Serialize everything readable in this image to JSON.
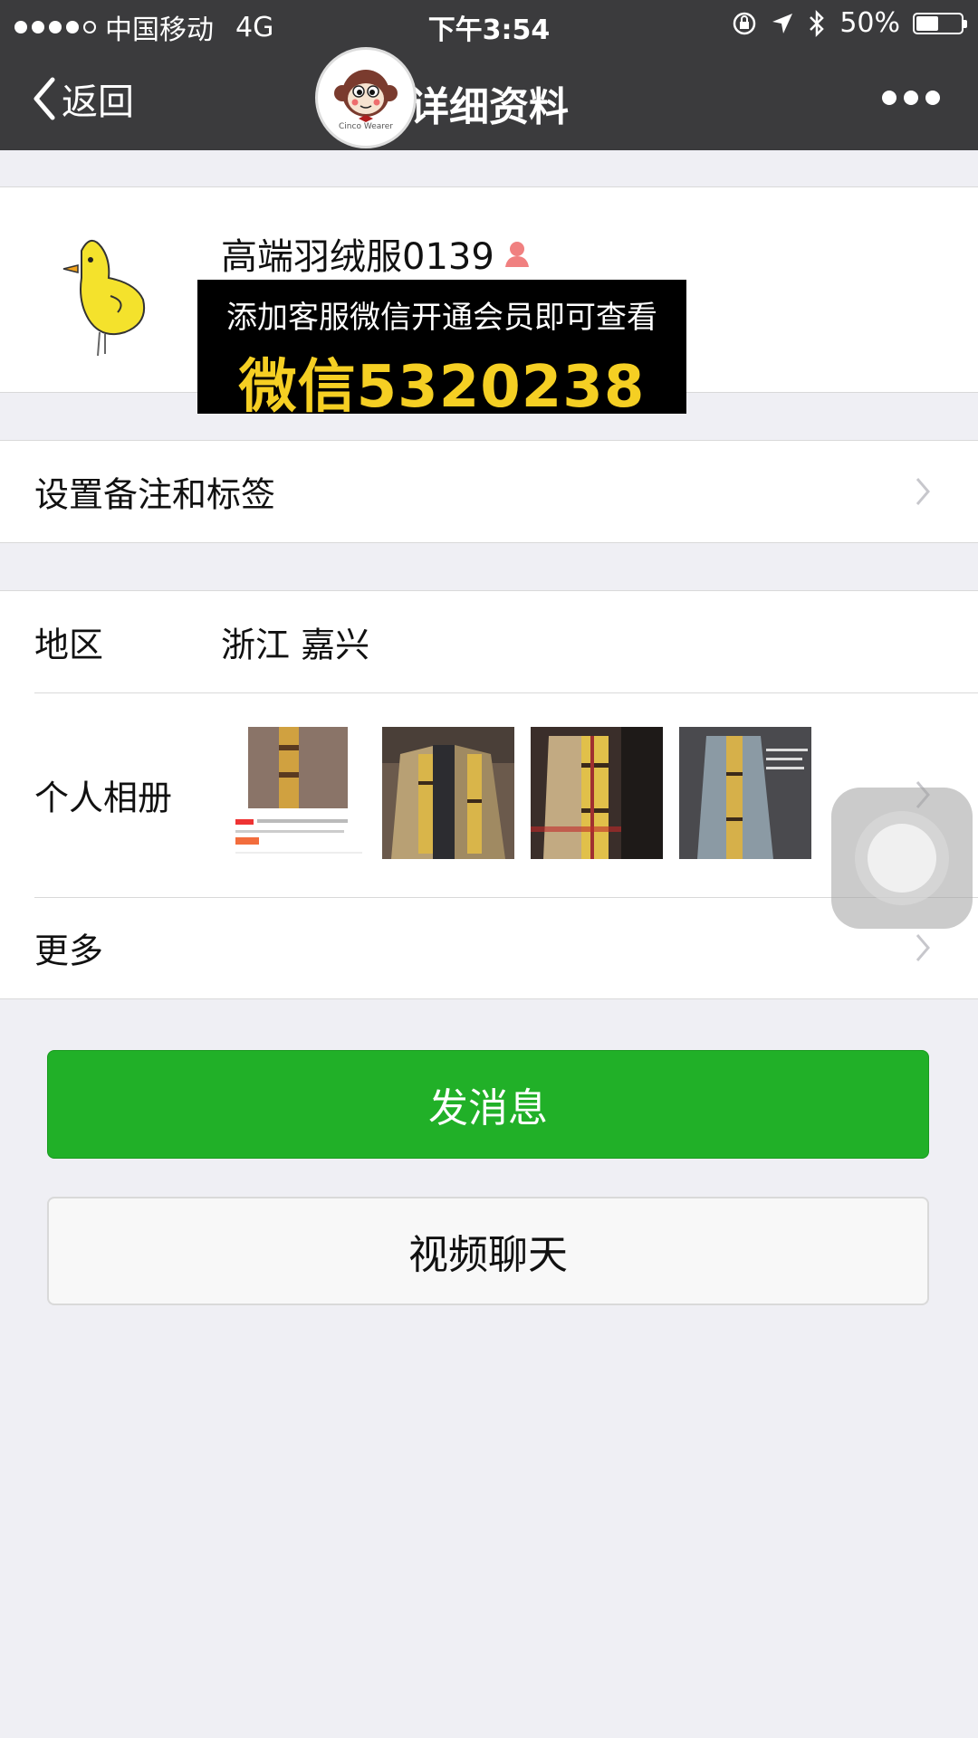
{
  "status_bar": {
    "carrier": "中国移动",
    "network": "4G",
    "time": "下午3:54",
    "battery": "50%",
    "battery_level": 0.5
  },
  "nav": {
    "back_label": "返回",
    "title": "详细资料",
    "logo_caption": "Cinco Wearer"
  },
  "profile": {
    "name": "高端羽绒服0139",
    "gender_icon": "female-user-icon"
  },
  "banner": {
    "line1": "添加客服微信开通会员即可查看",
    "line2": "微信5320238"
  },
  "remark": {
    "label": "设置备注和标签"
  },
  "region": {
    "label": "地区",
    "value": "浙江 嘉兴"
  },
  "album": {
    "label": "个人相册",
    "thumbnails": [
      "scarf-post-screenshot",
      "plaid-scarf-coat-photo",
      "plaid-scarf-model-photo",
      "grey-coat-plaid-scarf-photo"
    ]
  },
  "more": {
    "label": "更多"
  },
  "buttons": {
    "send_message": "发消息",
    "video_chat": "视频聊天"
  },
  "colors": {
    "nav_bg": "#3b3b3d",
    "primary_green": "#21b028",
    "banner_yellow": "#f5cf23",
    "page_bg": "#efeff4"
  }
}
